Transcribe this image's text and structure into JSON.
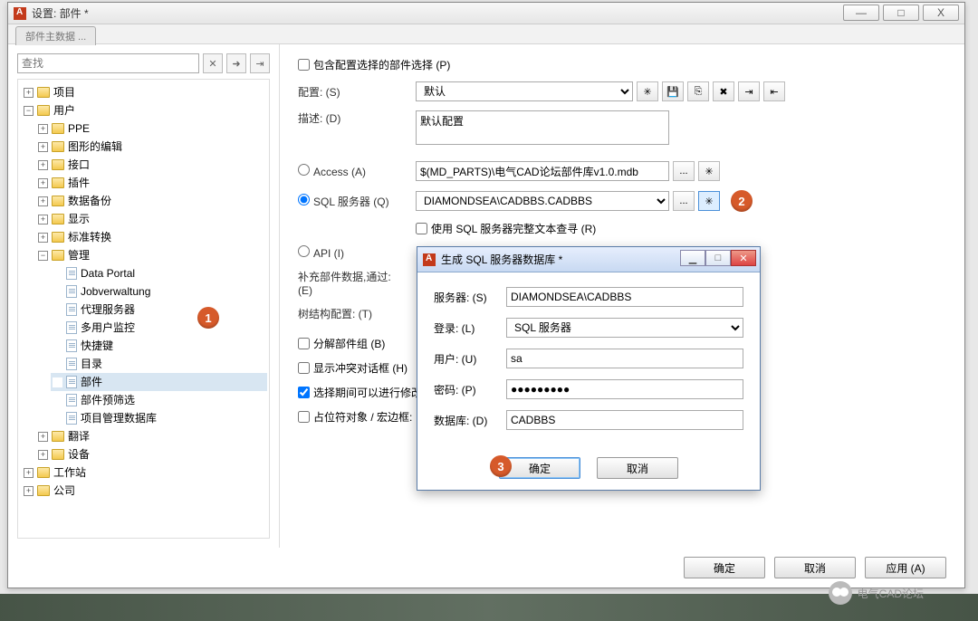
{
  "window": {
    "title": "设置: 部件 *",
    "min": "—",
    "max": "□",
    "close": "X"
  },
  "tab_blurred": "部件主数据 ...",
  "search": {
    "placeholder": "查找",
    "clear": "✕",
    "go": "➜",
    "transfer": "⇥"
  },
  "tree": {
    "n_project": "项目",
    "n_user": "用户",
    "n_ppe": "PPE",
    "n_graphics": "图形的编辑",
    "n_interface": "接口",
    "n_plugins": "插件",
    "n_backup": "数据备份",
    "n_display": "显示",
    "n_stdconv": "标准转换",
    "n_admin": "管理",
    "n_dataportal": "Data Portal",
    "n_jobverwaltung": "Jobverwaltung",
    "n_proxy": "代理服务器",
    "n_multiuser": "多用户监控",
    "n_shortcuts": "快捷键",
    "n_catalog": "目录",
    "n_parts": "部件",
    "n_prefilter": "部件预筛选",
    "n_projmgmtdb": "项目管理数据库",
    "n_translate": "翻译",
    "n_device": "设备",
    "n_workstation": "工作站",
    "n_company": "公司"
  },
  "form": {
    "chk_include_config": "包含配置选择的部件选择 (P)",
    "lbl_config": "配置: (S)",
    "config_value": "默认",
    "lbl_desc": "描述: (D)",
    "desc_value": "默认配置",
    "radio_access": "Access (A)",
    "access_path": "$(MD_PARTS)\\电气CAD论坛部件库v1.0.mdb",
    "radio_sql": "SQL 服务器 (Q)",
    "sql_value": "DIAMONDSEA\\CADBBS.CADBBS",
    "chk_fulltext": "使用 SQL 服务器完整文本查寻 (R)",
    "radio_api": "API (I)",
    "lbl_supply": "补充部件数据,通过: (E)",
    "lbl_treecfg": "树结构配置: (T)",
    "chk_decompose": "分解部件组 (B)",
    "chk_conflict": "显示冲突对话框 (H)",
    "chk_editselect": "选择期间可以进行修改",
    "chk_placeholder": "占位符对象 / 宏边框:",
    "btn_browse": "...",
    "btn_star": "✳"
  },
  "modal": {
    "title": "生成 SQL 服务器数据库 *",
    "lbl_server": "服务器: (S)",
    "server_value": "DIAMONDSEA\\CADBBS",
    "lbl_login": "登录: (L)",
    "login_value": "SQL 服务器",
    "lbl_user": "用户: (U)",
    "user_value": "sa",
    "lbl_pwd": "密码: (P)",
    "pwd_value": "●●●●●●●●●",
    "lbl_db": "数据库: (D)",
    "db_value": "CADBBS",
    "ok": "确定",
    "cancel": "取消",
    "min_i": "▁",
    "max_i": "□"
  },
  "badges": {
    "b1": "1",
    "b2": "2",
    "b3": "3"
  },
  "footer": {
    "ok": "确定",
    "cancel": "取消",
    "apply": "应用 (A)"
  },
  "wechat": "电气CAD论坛"
}
